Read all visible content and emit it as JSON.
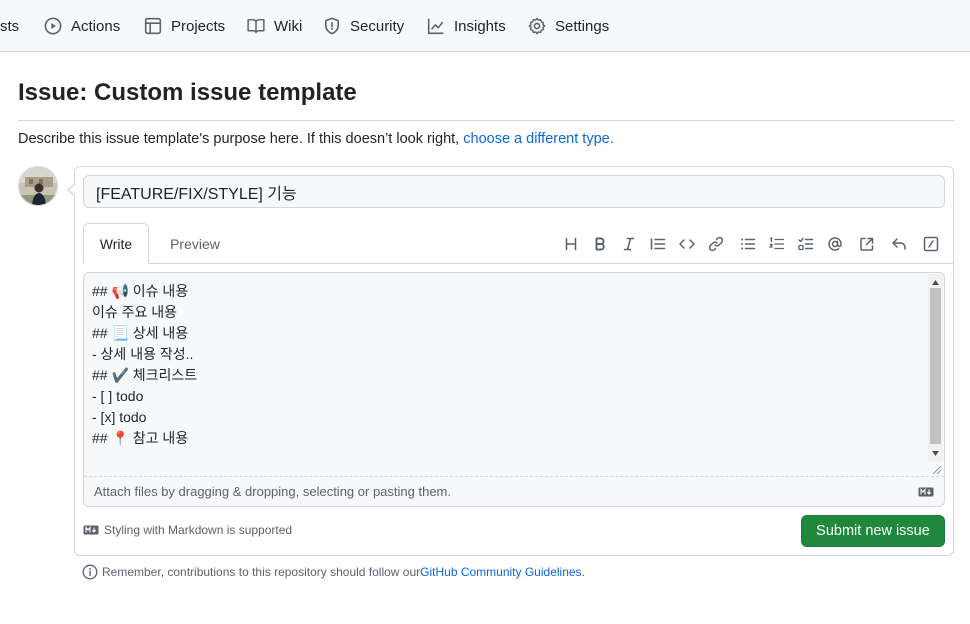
{
  "nav": {
    "items": [
      {
        "label": "sts"
      },
      {
        "label": "Actions",
        "icon": "play-icon"
      },
      {
        "label": "Projects",
        "icon": "table-icon"
      },
      {
        "label": "Wiki",
        "icon": "book-icon"
      },
      {
        "label": "Security",
        "icon": "shield-icon"
      },
      {
        "label": "Insights",
        "icon": "graph-icon"
      },
      {
        "label": "Settings",
        "icon": "gear-icon"
      }
    ]
  },
  "page": {
    "title": "Issue: Custom issue template",
    "description": "Describe this issue template's purpose here. If this doesn’t look right, ",
    "description_link": "choose a different type."
  },
  "form": {
    "title_value": "[FEATURE/FIX/STYLE] 기능",
    "tabs": {
      "write": "Write",
      "preview": "Preview"
    },
    "toolbar": [
      "heading-icon",
      "bold-icon",
      "italic-icon",
      "quote-icon",
      "code-icon",
      "link-icon",
      "unordered-list-icon",
      "ordered-list-icon",
      "task-list-icon",
      "mention-icon",
      "reference-icon",
      "reply-icon",
      "slash-icon"
    ],
    "body": "## 📢 이슈 내용\n이슈 주요 내용\n## 📃 상세 내용\n- 상세 내용 작성..\n## ✔️ 체크리스트\n- [ ] todo\n- [x] todo\n## 📍 참고 내용",
    "attach_hint": "Attach files by dragging & dropping, selecting or pasting them.",
    "markdown_hint": "Styling with Markdown is supported",
    "submit_label": "Submit new issue"
  },
  "footer": {
    "note": "Remember, contributions to this repository should follow our ",
    "link": "GitHub Community Guidelines",
    "suffix": "."
  },
  "colors": {
    "accent": "#0969da",
    "submit": "#1f883d",
    "border": "#d0d7de",
    "muted": "#59636e"
  }
}
